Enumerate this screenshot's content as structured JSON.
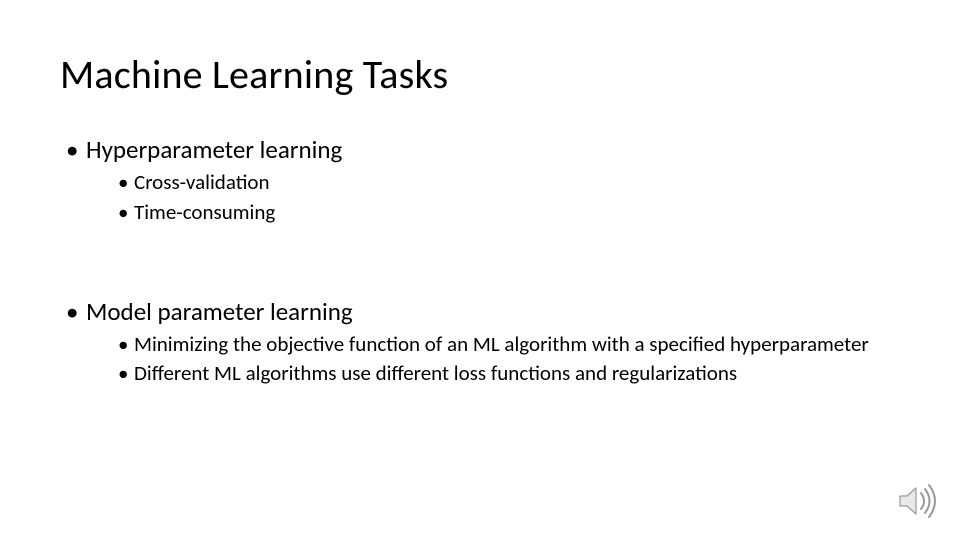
{
  "slide": {
    "title": "Machine Learning Tasks",
    "sections": [
      {
        "heading": "Hyperparameter learning",
        "items": [
          "Cross-validation",
          "Time-consuming"
        ]
      },
      {
        "heading": "Model parameter learning",
        "items": [
          "Minimizing the objective function of an ML algorithm with a specified hyperparameter",
          "Different ML algorithms use  different loss functions and regularizations"
        ]
      }
    ]
  }
}
